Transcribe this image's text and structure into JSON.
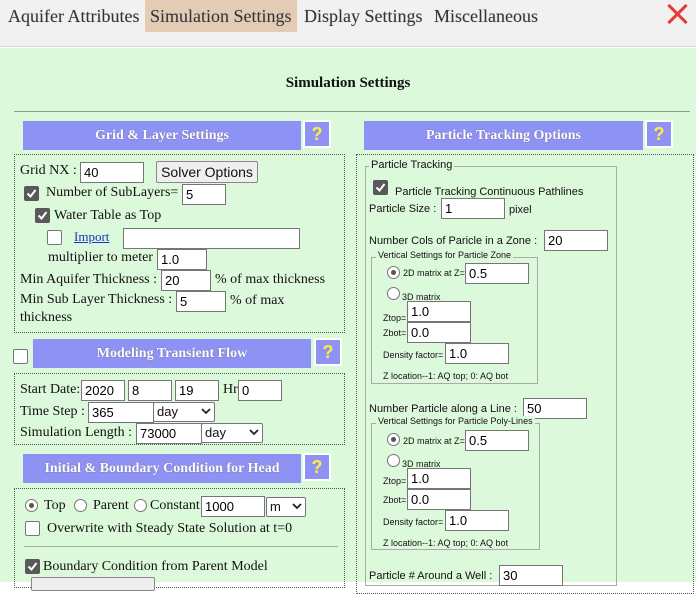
{
  "tabs": [
    {
      "label": "Aquifer Attributes",
      "active": false
    },
    {
      "label": "Simulation Settings",
      "active": true
    },
    {
      "label": "Display Settings",
      "active": false
    },
    {
      "label": "Miscellaneous",
      "active": false
    }
  ],
  "page_title": "Simulation Settings",
  "help_glyph": "?",
  "grid": {
    "header": "Grid & Layer Settings",
    "grid_nx_label": "Grid NX :",
    "grid_nx_value": "40",
    "solver_button": "Solver Options",
    "sublayers_label": "Number of SubLayers=",
    "sublayers_value": "5",
    "water_table_label": "Water Table as Top",
    "import_link": "Import",
    "import_value": "",
    "multiplier_label": "multiplier to meter",
    "multiplier_value": "1.0",
    "min_aquifer_label": "Min Aquifer Thickness :",
    "min_aquifer_value": "20",
    "min_aquifer_unit": "% of max thickness",
    "min_sub_label": "Min Sub Layer Thickness :",
    "min_sub_value": "5",
    "min_sub_unit": "% of max",
    "min_sub_unit2": "thickness"
  },
  "transient": {
    "header": "Modeling Transient Flow",
    "start_date_label": "Start Date:",
    "year": "2020",
    "month": "8",
    "day": "19",
    "hr_label": "Hr",
    "hr_value": "0",
    "time_step_label": "Time Step :",
    "time_step_value": "365",
    "time_step_unit": "day",
    "sim_length_label": "Simulation Length :",
    "sim_length_value": "73000",
    "sim_length_unit": "day"
  },
  "initial": {
    "header": "Initial & Boundary Condition for Head",
    "opt_top": "Top",
    "opt_parent": "Parent",
    "opt_constant": "Constant",
    "constant_value": "1000",
    "constant_unit": "m",
    "overwrite_label": "Overwrite with Steady State Solution at t=0",
    "boundary_label": "Boundary Condition from Parent Model"
  },
  "particle": {
    "header": "Particle Tracking Options",
    "legend": "Particle Tracking",
    "continuous_label": "Particle Tracking Continuous Pathlines",
    "size_label": "Particle Size :",
    "size_value": "1",
    "size_unit": "pixel",
    "ncols_label": "Number Cols of Paricle in a Zone :",
    "ncols_value": "20",
    "zone": {
      "legend": "Vertical Settings for Particle Zone",
      "matrix2d_label": "2D matrix at Z=",
      "matrix2d_value": "0.5",
      "matrix3d_label": "3D matrix",
      "ztop_label": "Ztop=",
      "ztop_value": "1.0",
      "zbot_label": "Zbot=",
      "zbot_value": "0.0",
      "density_label": "Density factor=",
      "density_value": "1.0",
      "note": "Z location--1: AQ top; 0: AQ bot"
    },
    "nline_label": "Number Particle along a Line :",
    "nline_value": "50",
    "polyline": {
      "legend": "Vertical Settings for Particle Poly-Lines",
      "matrix2d_label": "2D matrix at Z=",
      "matrix2d_value": "0.5",
      "matrix3d_label": "3D matrix",
      "ztop_label": "Ztop=",
      "ztop_value": "1.0",
      "zbot_label": "Zbot=",
      "zbot_value": "0.0",
      "density_label": "Density factor=",
      "density_value": "1.0",
      "note": "Z location--1: AQ top; 0: AQ bot"
    },
    "around_well_label": "Particle # Around a Well :",
    "around_well_value": "30"
  }
}
